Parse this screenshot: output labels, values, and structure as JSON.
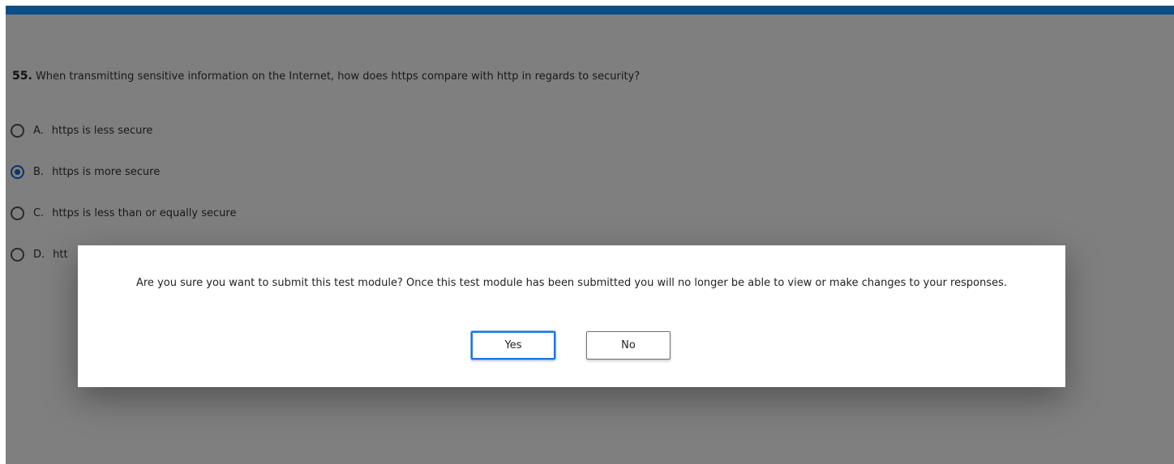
{
  "question": {
    "number": "55.",
    "text": "When transmitting sensitive information on the Internet, how does https compare with http in regards to security?"
  },
  "options": [
    {
      "letter": "A.",
      "text": "https is less secure",
      "selected": false
    },
    {
      "letter": "B.",
      "text": "https is more secure",
      "selected": true
    },
    {
      "letter": "C.",
      "text": "https is less than or equally secure",
      "selected": false
    },
    {
      "letter": "D.",
      "text": "htt",
      "selected": false
    }
  ],
  "dialog": {
    "message": "Are you sure you want to submit this test module? Once this test module has been submitted you will no longer be able to view or make changes to your responses.",
    "yes_label": "Yes",
    "no_label": "No"
  },
  "colors": {
    "header_bar": "#0b4f86",
    "accent": "#1a73e8",
    "overlay": "rgba(0,0,0,0.5)"
  }
}
